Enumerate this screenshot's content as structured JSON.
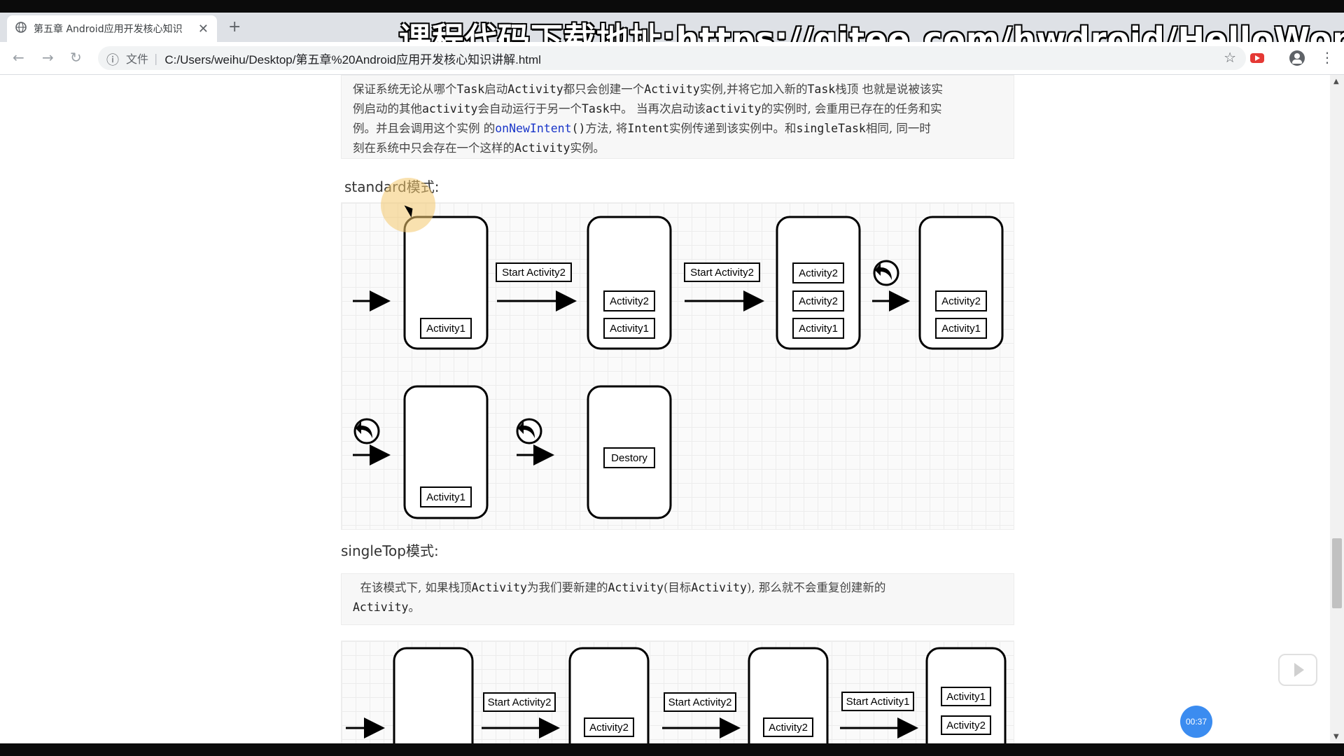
{
  "browser": {
    "tab_title": "第五章 Android应用开发核心知识",
    "url_prefix": "文件",
    "url": "C:/Users/weihu/Desktop/第五章%20Android应用开发核心知识讲解.html",
    "icons": [
      "globe-icon",
      "close-icon",
      "plus-icon",
      "back-arrow-icon",
      "forward-arrow-icon",
      "reload-icon",
      "info-icon",
      "star-icon",
      "youtube-icon",
      "profile-icon",
      "menu-dots-icon"
    ]
  },
  "overlay": {
    "title": "课程代码下载地址:https://gitee.com/hwdroid/HelloWorld"
  },
  "content": {
    "intro_line1_a": "保证系统无论从哪个",
    "intro_line1_b": "Task",
    "intro_line1_c": "启动",
    "intro_line1_d": "Activity",
    "intro_line1_e": "都只会创建一个",
    "intro_line1_f": "Activity",
    "intro_line1_g": "实例,并将它加入新的",
    "intro_line1_h": "Task",
    "intro_line1_i": "栈顶 也就是说被该实",
    "intro_line2_a": "例启动的其他",
    "intro_line2_b": "activity",
    "intro_line2_c": "会自动运行于另一个",
    "intro_line2_d": "Task",
    "intro_line2_e": "中。 当再次启动该",
    "intro_line2_f": "activity",
    "intro_line2_g": "的实例时, 会重用已存在的任务和实",
    "intro_line3_a": "例。并且会调用这个实例 的",
    "intro_line3_b": "onNewIntent",
    "intro_line3_c": "()",
    "intro_line3_d": "方法, 将",
    "intro_line3_e": "Intent",
    "intro_line3_f": "实例传递到该实例中。和",
    "intro_line3_g": "singleTask",
    "intro_line3_h": "相同, 同一时",
    "intro_line4_a": "刻在系统中只会存在一个这样的",
    "intro_line4_b": "Activity",
    "intro_line4_c": "实例。",
    "standard_heading": "standard模式:",
    "singletop_heading": "singleTop模式:",
    "singletop_desc_a": "在该模式下, 如果栈顶",
    "singletop_desc_b": "Activity",
    "singletop_desc_c": "为我们要新建的",
    "singletop_desc_d": "Activity",
    "singletop_desc_e": "(目标",
    "singletop_desc_f": "Activity",
    "singletop_desc_g": "), 那么就不会重复创建新的",
    "singletop_desc_h": "Activity",
    "singletop_desc_i": "。"
  },
  "diagram_standard": {
    "start_label": "Start Activity2",
    "activity1": "Activity1",
    "activity2": "Activity2",
    "destroy": "Destory"
  },
  "diagram_singletop": {
    "start2": "Start Activity2",
    "start1": "Start Activity1",
    "activity1": "Activity1",
    "activity2": "Activity2"
  },
  "player": {
    "time": "00:37"
  }
}
